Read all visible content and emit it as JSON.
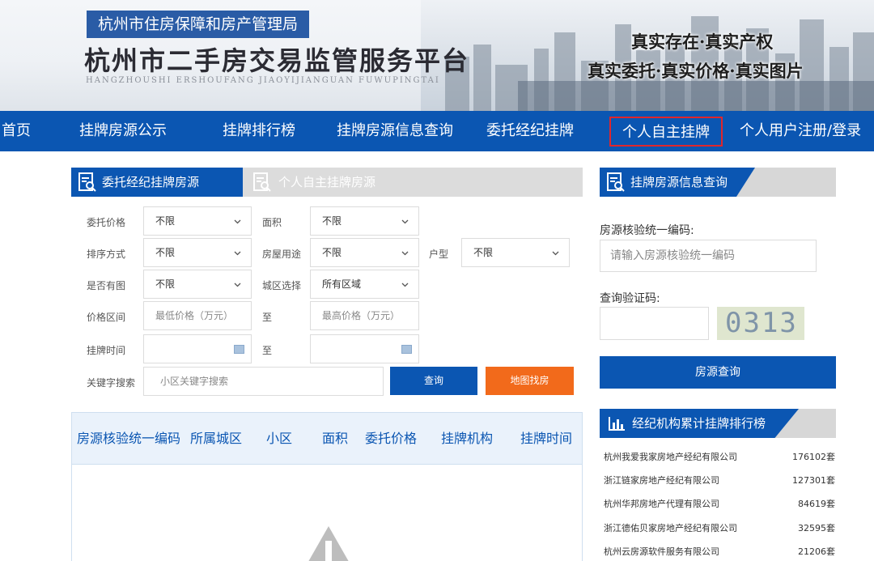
{
  "header": {
    "bureau": "杭州市住房保障和房产管理局",
    "platform": "杭州市二手房交易监管服务平台",
    "pinyin": "HANGZHOUSHI   ERSHOUFANG   JIAOYIJIANGUAN   FUWUPINGTAI",
    "slogan_line1": "真实存在·真实产权",
    "slogan_line2": "真实委托·真实价格·真实图片"
  },
  "nav": {
    "items": [
      "首页",
      "挂牌房源公示",
      "挂牌排行榜",
      "挂牌房源信息查询",
      "委托经纪挂牌",
      "个人自主挂牌",
      "个人用户注册/登录"
    ],
    "active_index": 5
  },
  "tabs": {
    "agent": "委托经纪挂牌房源",
    "personal": "个人自主挂牌房源"
  },
  "filters": {
    "price_label": "委托价格",
    "price_value": "不限",
    "area_label": "面积",
    "area_value": "不限",
    "sort_label": "排序方式",
    "sort_value": "不限",
    "usage_label": "房屋用途",
    "usage_value": "不限",
    "layout_label": "户型",
    "layout_value": "不限",
    "image_label": "是否有图",
    "image_value": "不限",
    "district_label": "城区选择",
    "district_value": "所有区域",
    "range_label": "价格区间",
    "min_price_placeholder": "最低价格（万元）",
    "to_label": "至",
    "max_price_placeholder": "最高价格（万元）",
    "time_label": "挂牌时间",
    "time_to_label": "至",
    "keyword_label": "关键字搜索",
    "keyword_placeholder": "小区关键字搜索",
    "query_button": "查询",
    "map_button": "地图找房"
  },
  "table": {
    "headers": [
      "房源核验统一编码",
      "所属城区",
      "小区",
      "面积",
      "委托价格",
      "挂牌机构",
      "挂牌时间"
    ]
  },
  "query_panel": {
    "title": "挂牌房源信息查询",
    "code_label": "房源核验统一编码:",
    "code_placeholder": "请输入房源核验统一编码",
    "verify_label": "查询验证码:",
    "captcha_text": "0313",
    "button": "房源查询"
  },
  "ranking": {
    "title": "经纪机构累计挂牌排行榜",
    "rows": [
      {
        "name": "杭州我爱我家房地产经纪有限公司",
        "count": "176102套"
      },
      {
        "name": "浙江链家房地产经纪有限公司",
        "count": "127301套"
      },
      {
        "name": "杭州华邦房地产代理有限公司",
        "count": "84619套"
      },
      {
        "name": "浙江德佑贝家房地产经纪有限公司",
        "count": "32595套"
      },
      {
        "name": "杭州云房源软件服务有限公司",
        "count": "21206套"
      }
    ]
  },
  "colors": {
    "primary": "#0b56b2",
    "accent_orange": "#f26a1b",
    "active_border": "#e0262c"
  }
}
